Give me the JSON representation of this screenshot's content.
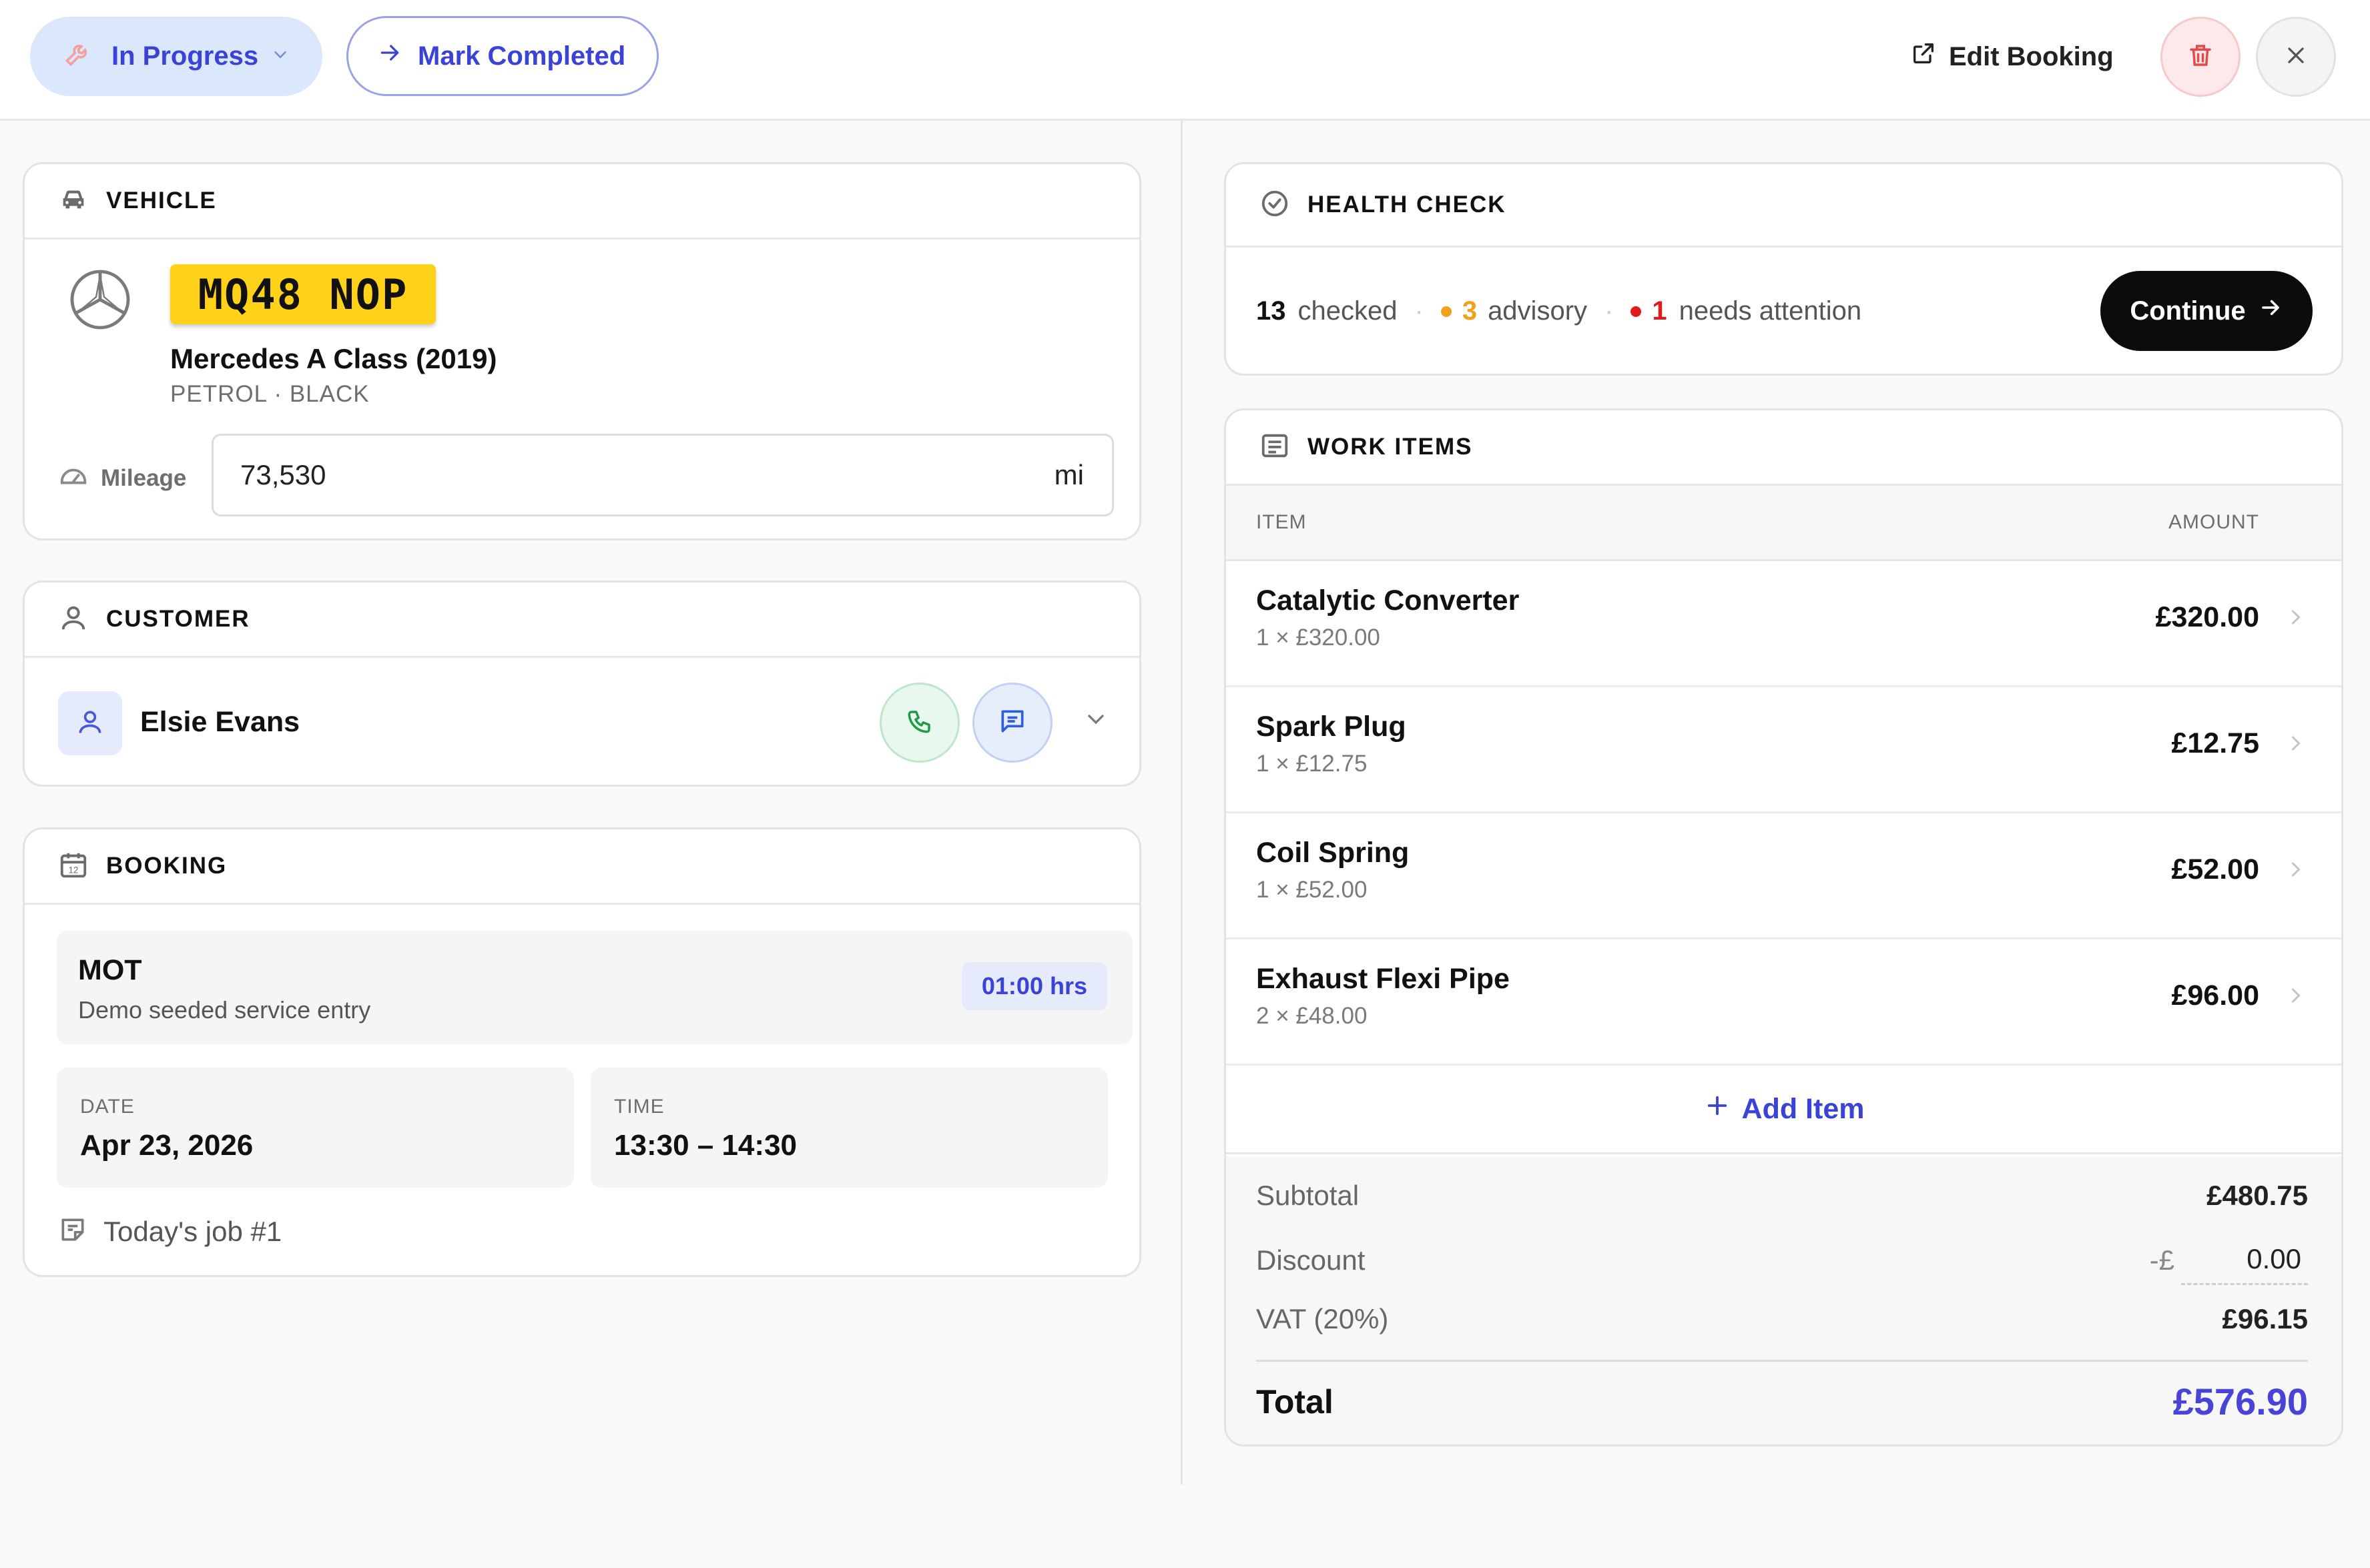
{
  "toolbar": {
    "status_label": "In Progress",
    "mark_completed_label": "Mark Completed",
    "edit_booking_label": "Edit Booking"
  },
  "vehicle": {
    "section_title": "VEHICLE",
    "plate": "MQ48 NOP",
    "model": "Mercedes A Class (2019)",
    "details": "PETROL · BLACK",
    "mileage_label": "Mileage",
    "mileage_value": "73,530",
    "mileage_unit": "mi"
  },
  "customer": {
    "section_title": "CUSTOMER",
    "name": "Elsie Evans"
  },
  "booking": {
    "section_title": "BOOKING",
    "service_name": "MOT",
    "service_desc": "Demo seeded service entry",
    "duration": "01:00 hrs",
    "date_label": "DATE",
    "date_value": "Apr 23, 2026",
    "time_label": "TIME",
    "time_value": "13:30 – 14:30",
    "note": "Today's job #1"
  },
  "health_check": {
    "section_title": "HEALTH CHECK",
    "checked_count": "13",
    "checked_label": "checked",
    "advisory_count": "3",
    "advisory_label": "advisory",
    "attention_count": "1",
    "attention_label": "needs attention",
    "continue_label": "Continue"
  },
  "work_items": {
    "section_title": "WORK ITEMS",
    "col_item": "ITEM",
    "col_amount": "AMOUNT",
    "items": [
      {
        "name": "Catalytic Converter",
        "qty": "1 × £320.00",
        "amount": "£320.00"
      },
      {
        "name": "Spark Plug",
        "qty": "1 × £12.75",
        "amount": "£12.75"
      },
      {
        "name": "Coil Spring",
        "qty": "1 × £52.00",
        "amount": "£52.00"
      },
      {
        "name": "Exhaust Flexi Pipe",
        "qty": "2 × £48.00",
        "amount": "£96.00"
      }
    ],
    "add_item_label": "Add Item",
    "subtotal_label": "Subtotal",
    "subtotal_value": "£480.75",
    "discount_label": "Discount",
    "discount_prefix": "-£",
    "discount_value": "0.00",
    "vat_label": "VAT (20%)",
    "vat_value": "£96.15",
    "total_label": "Total",
    "total_value": "£576.90"
  },
  "colors": {
    "accent": "#3b43d6",
    "advisory": "#f0a21a",
    "attention": "#e01b1b",
    "plate": "#ffd21a",
    "call": "#1f9a45",
    "message": "#2f5fd8"
  },
  "icons": [
    "wrench-icon",
    "chevron-down-icon",
    "arrow-right-icon",
    "external-link-icon",
    "trash-icon",
    "close-icon",
    "car-icon",
    "mercedes-logo-icon",
    "gauge-icon",
    "user-icon",
    "phone-icon",
    "message-icon",
    "calendar-icon",
    "note-icon",
    "check-circle-icon",
    "list-icon",
    "plus-icon",
    "chevron-right-icon"
  ]
}
